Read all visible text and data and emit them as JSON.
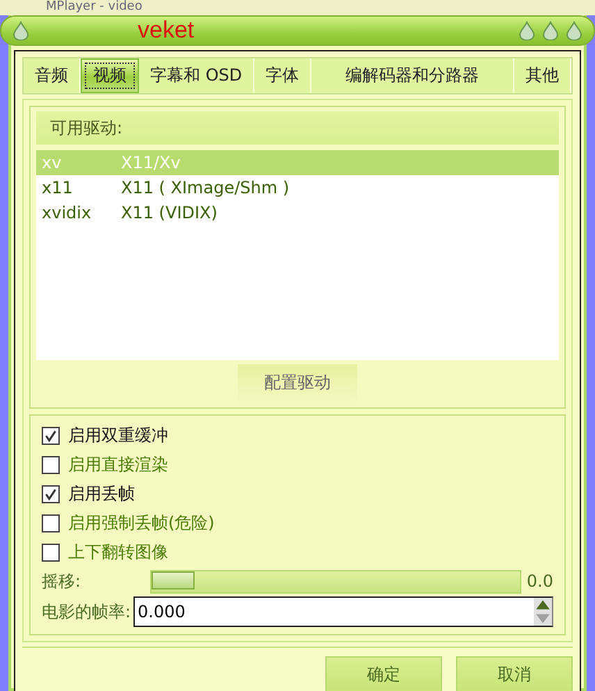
{
  "background_title": "MPlayer - video",
  "window": {
    "title": "veket"
  },
  "tabs": [
    {
      "label": "音频",
      "selected": false
    },
    {
      "label": "视频",
      "selected": true
    },
    {
      "label": "字幕和 OSD",
      "selected": false
    },
    {
      "label": "字体",
      "selected": false
    },
    {
      "label": "编解码器和分路器",
      "selected": false
    },
    {
      "label": "其他",
      "selected": false
    }
  ],
  "drivers": {
    "title": "可用驱动:",
    "rows": [
      {
        "name": "xv",
        "description": "X11/Xv",
        "selected": true
      },
      {
        "name": "x11",
        "description": "X11 ( XImage/Shm )",
        "selected": false
      },
      {
        "name": "xvidix",
        "description": "X11 (VIDIX)",
        "selected": false
      }
    ],
    "button": "配置驱动"
  },
  "options": [
    {
      "label": "启用双重缓冲",
      "checked": true
    },
    {
      "label": "启用直接渲染",
      "checked": false
    },
    {
      "label": "启用丢帧",
      "checked": true
    },
    {
      "label": "启用强制丢帧(危险)",
      "checked": false
    },
    {
      "label": "上下翻转图像",
      "checked": false
    }
  ],
  "panscan": {
    "label": "摇移:",
    "level": 0,
    "reading": "0.0"
  },
  "fps": {
    "label": "电影的帧率:",
    "value": "0.000"
  },
  "buttons": [
    "确定",
    "取消"
  ]
}
